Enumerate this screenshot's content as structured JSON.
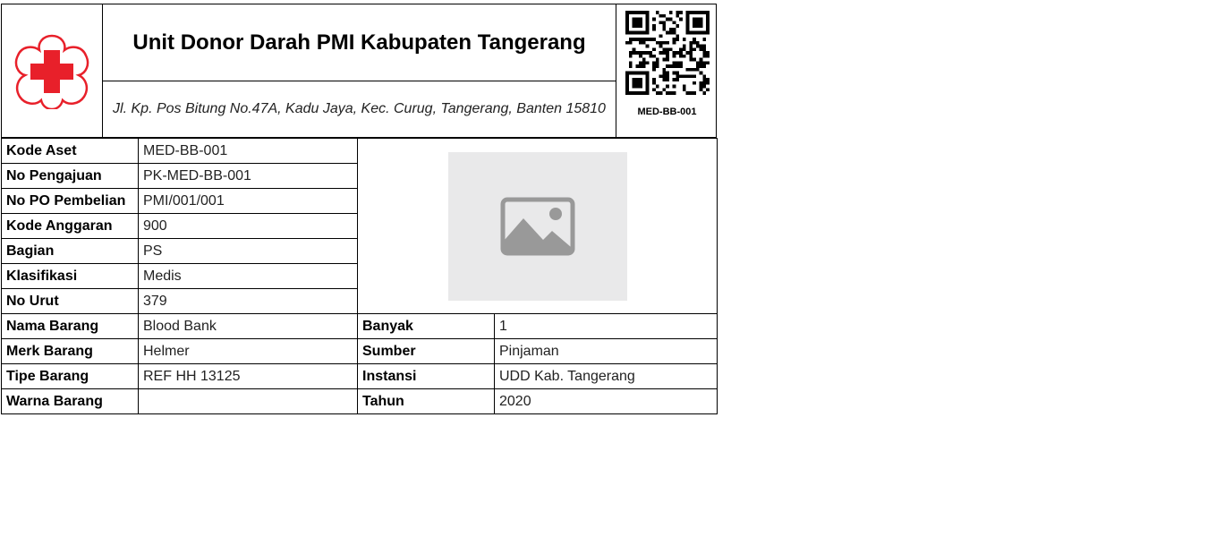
{
  "header": {
    "title": "Unit Donor Darah PMI Kabupaten Tangerang",
    "address": "Jl. Kp. Pos Bitung No.47A, Kadu Jaya, Kec. Curug, Tangerang, Banten 15810",
    "qr_label": "MED-BB-001",
    "logo_icon": "pmi-red-cross-logo-icon",
    "qr_icon": "qr-code-icon",
    "colors": {
      "logo_red": "#e8202a"
    }
  },
  "photo": {
    "icon": "image-placeholder-icon"
  },
  "fields": {
    "kode_aset": {
      "label": "Kode Aset",
      "value": "MED-BB-001"
    },
    "no_pengajuan": {
      "label": "No Pengajuan",
      "value": "PK-MED-BB-001"
    },
    "no_po": {
      "label": "No PO Pembelian",
      "value": "PMI/001/001"
    },
    "kode_anggaran": {
      "label": "Kode Anggaran",
      "value": "900"
    },
    "bagian": {
      "label": "Bagian",
      "value": "PS"
    },
    "klasifikasi": {
      "label": "Klasifikasi",
      "value": "Medis"
    },
    "no_urut": {
      "label": "No Urut",
      "value": "379"
    },
    "nama_barang": {
      "label": "Nama Barang",
      "value": "Blood Bank"
    },
    "merk_barang": {
      "label": "Merk Barang",
      "value": "Helmer"
    },
    "tipe_barang": {
      "label": "Tipe Barang",
      "value": "REF HH 13125"
    },
    "warna_barang": {
      "label": "Warna Barang",
      "value": ""
    },
    "banyak": {
      "label": "Banyak",
      "value": "1"
    },
    "sumber": {
      "label": "Sumber",
      "value": "Pinjaman"
    },
    "instansi": {
      "label": "Instansi",
      "value": "UDD Kab. Tangerang"
    },
    "tahun": {
      "label": "Tahun",
      "value": "2020"
    }
  }
}
